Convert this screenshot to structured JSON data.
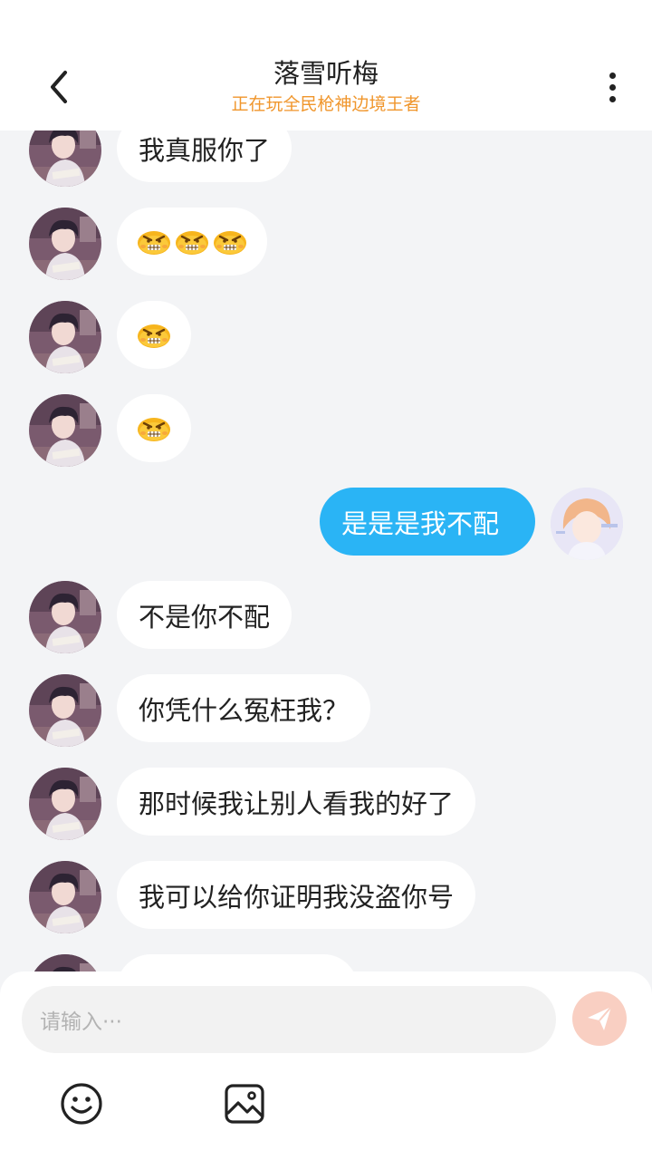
{
  "header": {
    "title": "落雪听梅",
    "status": "正在玩全民枪神边境王者"
  },
  "messages": [
    {
      "side": "left",
      "text": "我真服你了"
    },
    {
      "side": "left",
      "emoji": "angry-face-emoji",
      "count": 3
    },
    {
      "side": "left",
      "emoji": "angry-face-emoji",
      "count": 1
    },
    {
      "side": "left",
      "emoji": "angry-face-emoji",
      "count": 1
    },
    {
      "side": "right",
      "text": "是是是我不配"
    },
    {
      "side": "left",
      "text": "不是你不配"
    },
    {
      "side": "left",
      "text": "你凭什么冤枉我？"
    },
    {
      "side": "left",
      "text": "那时候我让别人看我的好了"
    },
    {
      "side": "left",
      "text": "我可以给你证明我没盗你号"
    },
    {
      "side": "left",
      "text": ""
    }
  ],
  "composer": {
    "placeholder": "请输入···"
  },
  "icons": {
    "back": "chevron-left-icon",
    "more": "more-vertical-icon",
    "send": "send-icon",
    "emoji": "smiley-icon",
    "image": "image-icon"
  },
  "colors": {
    "accent": "#2ab4f5",
    "status": "#f0962c",
    "background": "#f3f4f6",
    "send_disabled": "#f9cfc2"
  }
}
